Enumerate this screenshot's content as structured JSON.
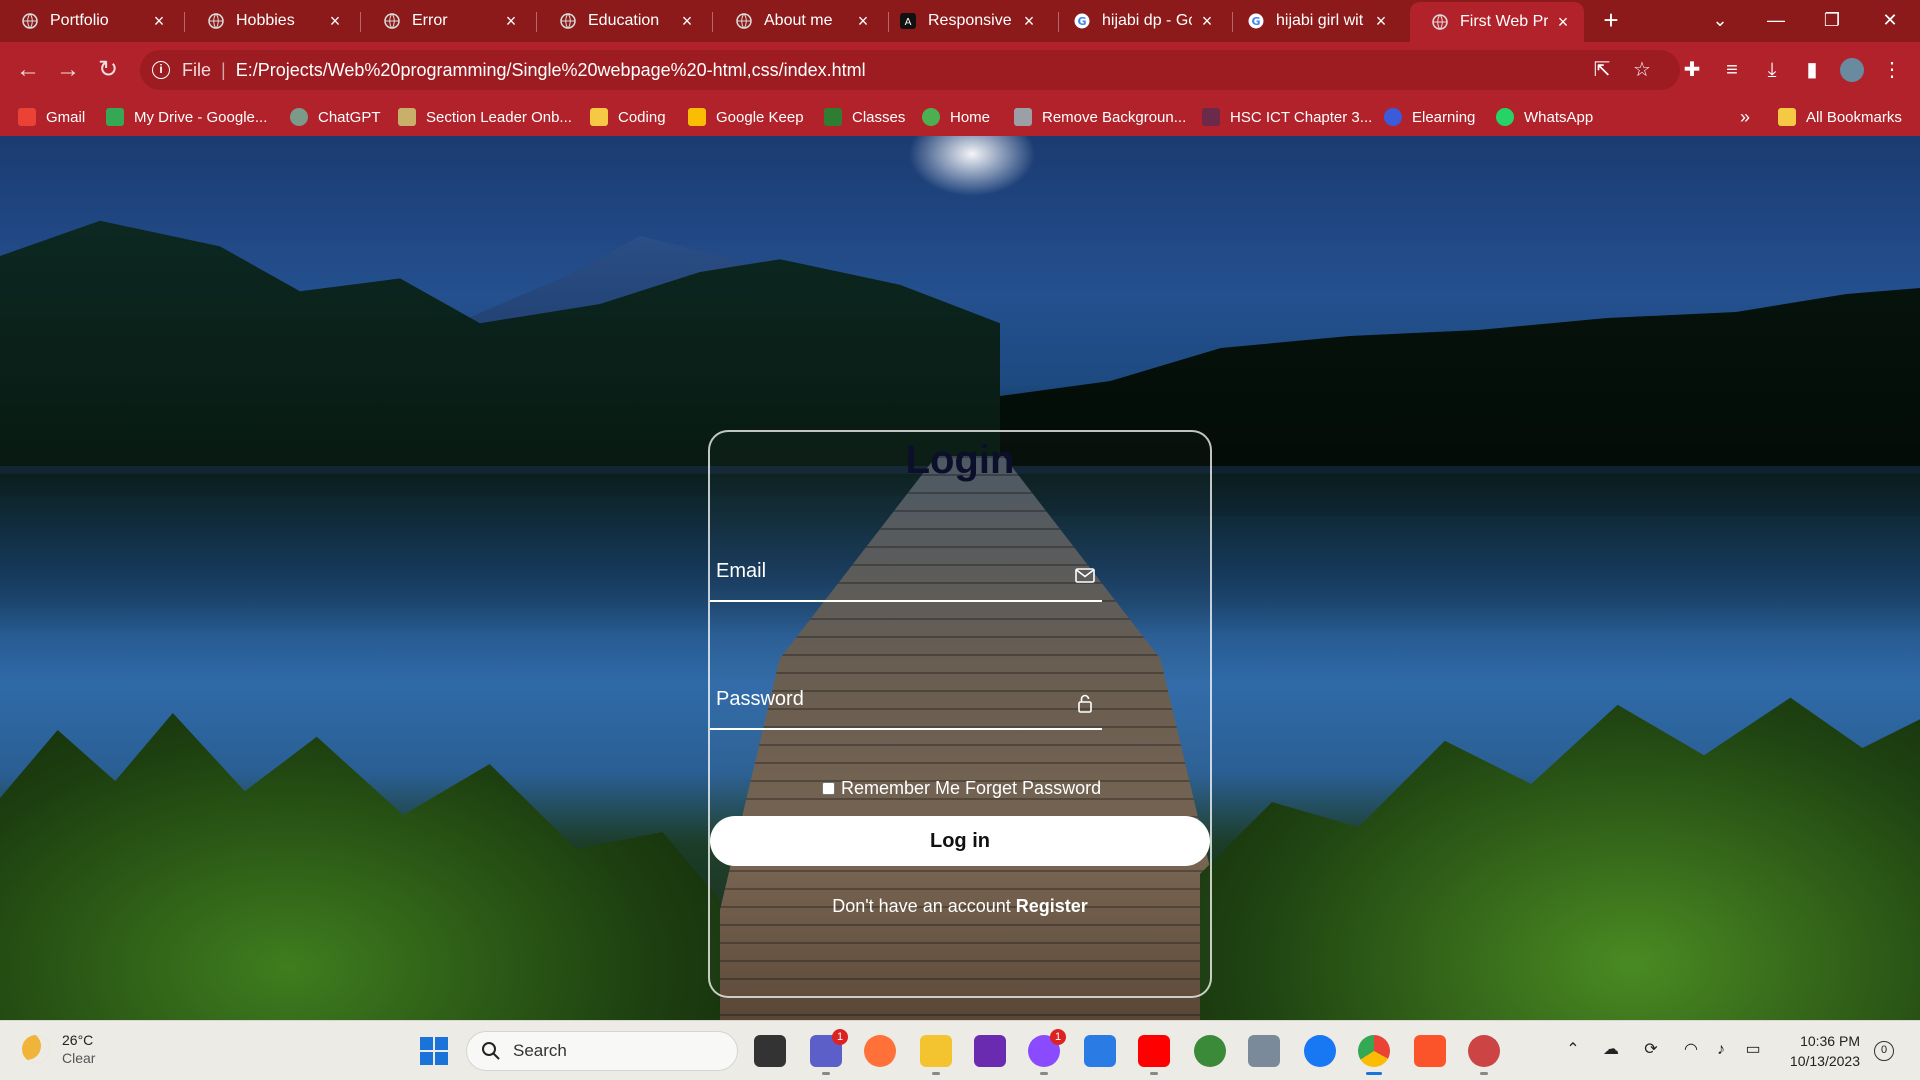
{
  "browser": {
    "tabs": [
      {
        "label": "Portfolio",
        "active": false
      },
      {
        "label": "Hobbies",
        "active": false
      },
      {
        "label": "Error",
        "active": false
      },
      {
        "label": "Education",
        "active": false
      },
      {
        "label": "About me",
        "active": false
      },
      {
        "label": "Responsive W",
        "active": false
      },
      {
        "label": "hijabi dp - Go",
        "active": false
      },
      {
        "label": "hijabi girl wit",
        "active": false
      },
      {
        "label": "First Web Pro",
        "active": true
      }
    ],
    "new_tab": "+",
    "address": {
      "scheme": "File",
      "url": "E:/Projects/Web%20programming/Single%20webpage%20-html,css/index.html"
    },
    "bookmarks": [
      {
        "label": "Gmail",
        "color": "#ea4335"
      },
      {
        "label": "My Drive - Google...",
        "color": "#34a853"
      },
      {
        "label": "ChatGPT",
        "color": "#7a9a8a"
      },
      {
        "label": "Section Leader Onb...",
        "color": "#c8b06a"
      },
      {
        "label": "Coding",
        "color": "#f6c945"
      },
      {
        "label": "Google Keep",
        "color": "#fbbc04"
      },
      {
        "label": "Classes",
        "color": "#2e7d32"
      },
      {
        "label": "Home",
        "color": "#4caf50"
      },
      {
        "label": "Remove Backgroun...",
        "color": "#9aa0a6"
      },
      {
        "label": "HSC ICT Chapter 3...",
        "color": "#6b2a4a"
      },
      {
        "label": "Elearning",
        "color": "#3b5bdb"
      },
      {
        "label": "WhatsApp",
        "color": "#25d366"
      }
    ],
    "bookmarks_overflow": "»",
    "all_bookmarks": "All Bookmarks"
  },
  "page": {
    "title": "Login",
    "email_label": "Email",
    "password_label": "Password",
    "remember_text": "Remember Me Forget Password",
    "login_button": "Log in",
    "register_prompt": "Don't have an account ",
    "register_link": "Register"
  },
  "taskbar": {
    "weather_temp": "26°C",
    "weather_cond": "Clear",
    "search_placeholder": "Search",
    "teams_badge": "1",
    "messenger_badge": "1",
    "time": "10:36 PM",
    "date": "10/13/2023",
    "notifications": "0"
  },
  "colors": {
    "chrome_bg": "#b2222a",
    "tabstrip_bg": "#8c1a1a",
    "accent": "#1a73d9"
  }
}
